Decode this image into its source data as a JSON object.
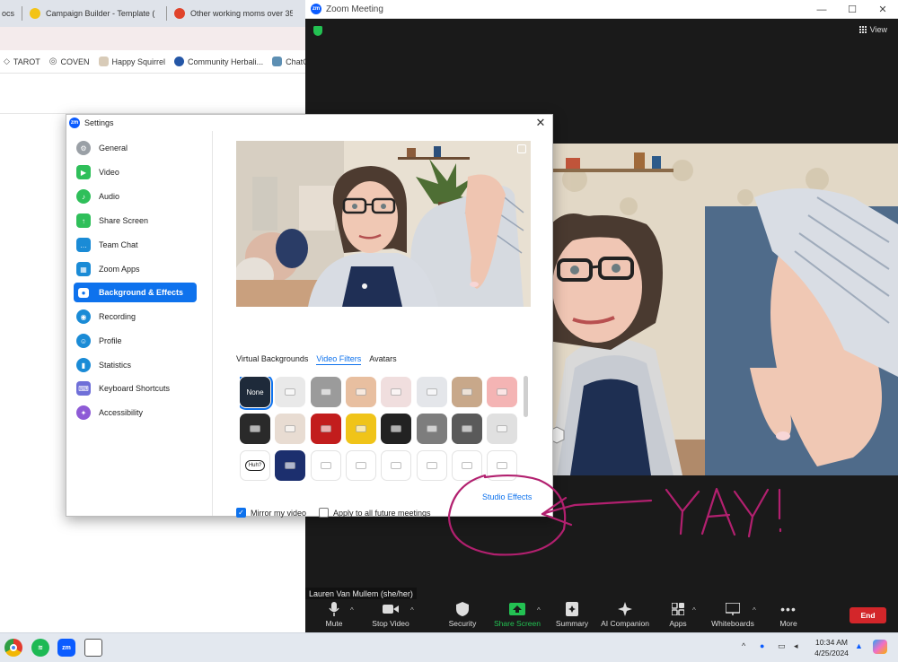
{
  "browser": {
    "tabs": [
      {
        "label": "ocs",
        "color": "#dfe3ea"
      },
      {
        "label": "Campaign Builder - Template (",
        "color": "#f3c316"
      },
      {
        "label": "Other working moms over 35",
        "color": "#e0432b"
      }
    ],
    "bookmarks": [
      {
        "label": "TAROT",
        "icon": "diamond-icon"
      },
      {
        "label": "COVEN",
        "icon": "globe-icon"
      },
      {
        "label": "Happy Squirrel",
        "icon": "squirrel-icon"
      },
      {
        "label": "Community Herbali...",
        "icon": "k-logo-icon"
      },
      {
        "label": "ChatGPT",
        "icon": "chatgpt-icon"
      }
    ]
  },
  "zoom": {
    "title": "Zoom Meeting",
    "logo_text": "zm",
    "view_label": "View",
    "participant_name": "Lauren Van Mullem (she/her)",
    "toolbar": {
      "mute": "Mute",
      "stop_video": "Stop Video",
      "security": "Security",
      "share_screen": "Share Screen",
      "summary": "Summary",
      "ai_companion": "AI Companion",
      "apps": "Apps",
      "whiteboards": "Whiteboards",
      "more": "More",
      "end": "End"
    },
    "colors": {
      "share_green": "#23c152",
      "end_red": "#d3262a"
    }
  },
  "settings": {
    "title": "Settings",
    "logo_text": "zm",
    "nav": [
      {
        "label": "General",
        "icon": "gear-icon",
        "color": "#9aa0a6"
      },
      {
        "label": "Video",
        "icon": "video-camera-icon",
        "color": "#2fbf5a"
      },
      {
        "label": "Audio",
        "icon": "headphones-icon",
        "color": "#2fbf5a"
      },
      {
        "label": "Share Screen",
        "icon": "share-screen-icon",
        "color": "#2fbf5a"
      },
      {
        "label": "Team Chat",
        "icon": "chat-bubble-icon",
        "color": "#1a8bd6"
      },
      {
        "label": "Zoom Apps",
        "icon": "apps-grid-icon",
        "color": "#1a8bd6"
      },
      {
        "label": "Background & Effects",
        "icon": "portrait-icon",
        "color": "#ffffff"
      },
      {
        "label": "Recording",
        "icon": "record-icon",
        "color": "#1a8bd6"
      },
      {
        "label": "Profile",
        "icon": "person-icon",
        "color": "#1a8bd6"
      },
      {
        "label": "Statistics",
        "icon": "bar-chart-icon",
        "color": "#1a8bd6"
      },
      {
        "label": "Keyboard Shortcuts",
        "icon": "keyboard-icon",
        "color": "#6f6fd8"
      },
      {
        "label": "Accessibility",
        "icon": "accessibility-icon",
        "color": "#8e5bd6"
      }
    ],
    "active_index": 6,
    "tabs": {
      "virtual_backgrounds": "Virtual Backgrounds",
      "video_filters": "Video Filters",
      "avatars": "Avatars"
    },
    "filter_none_label": "None",
    "filter_speech_text": "Huh?",
    "filters": [
      {
        "kind": "none",
        "color": "#1e2a3a"
      },
      {
        "kind": "light",
        "color": "#e9e9e9"
      },
      {
        "kind": "gray",
        "color": "#9b9b9b"
      },
      {
        "kind": "peach",
        "color": "#e8bfa0"
      },
      {
        "kind": "pink-light",
        "color": "#f0dede"
      },
      {
        "kind": "silver",
        "color": "#e4e6ea"
      },
      {
        "kind": "tan",
        "color": "#c8a88a"
      },
      {
        "kind": "pink",
        "color": "#f4b4b4"
      },
      {
        "kind": "tv-rainbow",
        "color": "#2a2a2a"
      },
      {
        "kind": "reindeer",
        "color": "#e8dcd2"
      },
      {
        "kind": "theater",
        "color": "#c21d1d"
      },
      {
        "kind": "sunflower",
        "color": "#f0c419"
      },
      {
        "kind": "film-strip",
        "color": "#222222"
      },
      {
        "kind": "focus-frame",
        "color": "#7d7d7d"
      },
      {
        "kind": "retro-tv",
        "color": "#5a5a5a"
      },
      {
        "kind": "ribbon",
        "color": "#e0e0e0"
      },
      {
        "kind": "speech-bubble",
        "color": "#ffffff"
      },
      {
        "kind": "party-lights",
        "color": "#1c2f6e"
      },
      {
        "kind": "sunglasses",
        "color": "#ffffff"
      },
      {
        "kind": "sprout",
        "color": "#ffffff"
      },
      {
        "kind": "halo",
        "color": "#ffffff"
      },
      {
        "kind": "party-hat",
        "color": "#ffffff"
      },
      {
        "kind": "cap",
        "color": "#ffffff"
      },
      {
        "kind": "blush",
        "color": "#ffffff"
      }
    ],
    "mirror_label": "Mirror my video",
    "mirror_checked": true,
    "apply_future_label": "Apply to all future meetings",
    "apply_future_checked": false,
    "studio_effects_label": "Studio Effects"
  },
  "annotation": {
    "text": "YAY!",
    "color": "#b2206f"
  },
  "taskbar": {
    "time": "10:34 AM",
    "date": "4/25/2024",
    "apps": [
      "chrome-icon",
      "spotify-icon",
      "zoom-icon",
      "snipping-tool-icon"
    ],
    "zoom_text": "zm"
  }
}
